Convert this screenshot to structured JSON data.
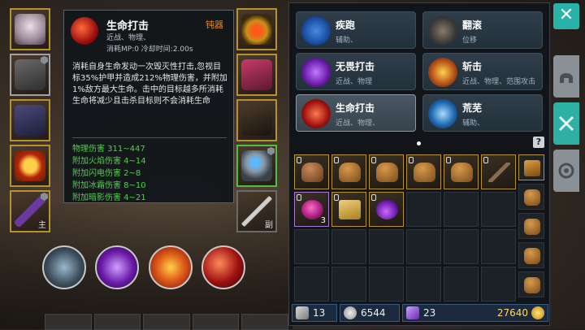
{
  "tooltip": {
    "title": "生命打击",
    "quality": "钝器",
    "tags": "近战、物理、",
    "cost": "消耗MP:0   冷却时间:2.00s",
    "description": "消耗自身生命发动一次毁灭性打击,忽视目标35%护甲并造成212%物理伤害，并附加1%敌方最大生命。击中的目标越多所消耗生命将减少且击杀目标则不会消耗生命",
    "stats": [
      "物理伤害 311~447",
      "附加火焰伤害 4~14",
      "附加闪电伤害 2~8",
      "附加冰霜伤害 8~10",
      "附加暗影伤害 4~21"
    ]
  },
  "equipment": {
    "mainhand_tag": "主",
    "offhand_tag": "副"
  },
  "skills": [
    {
      "name": "疾跑",
      "tags": "辅助、",
      "color": "#1a4ea0"
    },
    {
      "name": "翻滚",
      "tags": "位移",
      "color": "#3a3a3a"
    },
    {
      "name": "无畏打击",
      "tags": "近战、物理",
      "color": "#6a1aa8"
    },
    {
      "name": "斩击",
      "tags": "近战、物理、范围攻击",
      "color": "#b8541a"
    },
    {
      "name": "生命打击",
      "tags": "近战、物理、",
      "color": "#9e1010"
    },
    {
      "name": "荒芜",
      "tags": "辅助、",
      "color": "#1e6ab0"
    }
  ],
  "help_label": "?",
  "inventory": {
    "rows": 4,
    "count_label": "3"
  },
  "currency": {
    "keys": "13",
    "skulls": "6544",
    "gems": "23",
    "gold": "27640"
  },
  "close_label": "✕",
  "colors": {
    "accent": "#2fb0a5",
    "gold_border": "#b8912f",
    "stat_green": "#4fd24a"
  }
}
